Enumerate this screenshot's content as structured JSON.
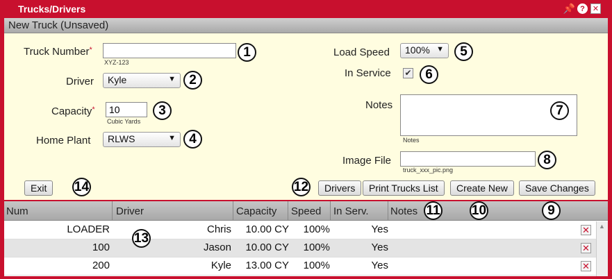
{
  "window": {
    "title": "Trucks/Drivers"
  },
  "header": {
    "subtitle": "New Truck (Unsaved)"
  },
  "form": {
    "truck_number": {
      "label": "Truck Number",
      "value": "",
      "hint": "XYZ-123"
    },
    "driver": {
      "label": "Driver",
      "value": "Kyle"
    },
    "capacity": {
      "label": "Capacity",
      "value": "10",
      "hint": "Cubic Yards"
    },
    "home_plant": {
      "label": "Home Plant",
      "value": "RLWS"
    },
    "load_speed": {
      "label": "Load Speed",
      "value": "100%"
    },
    "in_service": {
      "label": "In Service",
      "checked": true
    },
    "notes": {
      "label": "Notes",
      "value": "",
      "hint": "Notes"
    },
    "image_file": {
      "label": "Image File",
      "value": "",
      "hint": "truck_xxx_pic.png"
    },
    "required_mark": "*"
  },
  "buttons": {
    "exit": "Exit",
    "drivers": "Drivers",
    "print": "Print Trucks List",
    "create": "Create New",
    "save": "Save Changes"
  },
  "callouts": [
    "1",
    "2",
    "3",
    "4",
    "5",
    "6",
    "7",
    "8",
    "9",
    "10",
    "11",
    "12",
    "13",
    "14"
  ],
  "table": {
    "columns": [
      "Num",
      "Driver",
      "Capacity",
      "Speed",
      "In Serv.",
      "Notes"
    ],
    "rows": [
      {
        "num": "LOADER",
        "driver": "Chris",
        "capacity": "10.00 CY",
        "speed": "100%",
        "in_serv": "Yes",
        "notes": ""
      },
      {
        "num": "100",
        "driver": "Jason",
        "capacity": "10.00 CY",
        "speed": "100%",
        "in_serv": "Yes",
        "notes": ""
      },
      {
        "num": "200",
        "driver": "Kyle",
        "capacity": "13.00 CY",
        "speed": "100%",
        "in_serv": "Yes",
        "notes": ""
      }
    ]
  },
  "icons": {
    "pin": "pin-icon",
    "help": "help-icon",
    "close": "close-icon",
    "delete": "delete-icon",
    "check": "checkmark-icon",
    "caret": "caret-down-icon"
  },
  "colors": {
    "titlebar": "#c8102e",
    "form_bg": "#fffde0",
    "required": "#c8102e"
  }
}
